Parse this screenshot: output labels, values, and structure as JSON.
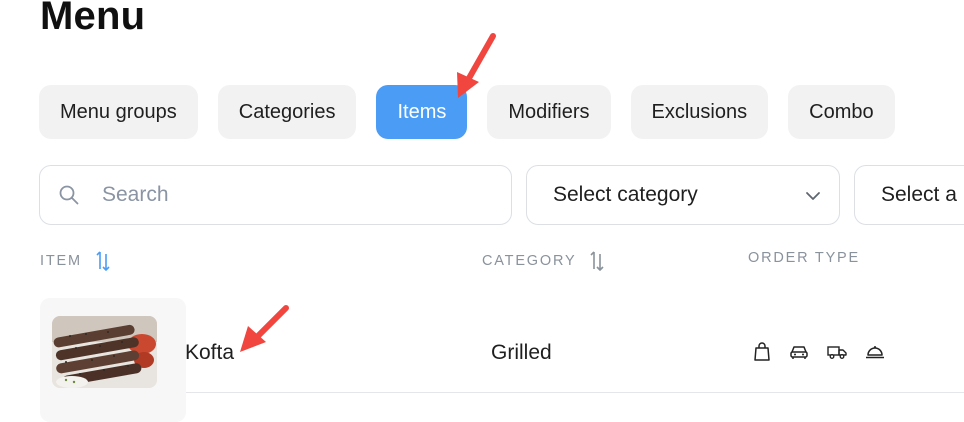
{
  "page": {
    "title": "Menu"
  },
  "tabs": [
    {
      "label": "Menu groups",
      "active": false
    },
    {
      "label": "Categories",
      "active": false
    },
    {
      "label": "Items",
      "active": true
    },
    {
      "label": "Modifiers",
      "active": false
    },
    {
      "label": "Exclusions",
      "active": false
    },
    {
      "label": "Combo",
      "active": false
    }
  ],
  "filters": {
    "search_placeholder": "Search",
    "category_select": "Select category",
    "second_select": "Select a"
  },
  "table": {
    "headers": {
      "item": "ITEM",
      "category": "CATEGORY",
      "order_type": "ORDER TYPE"
    },
    "rows": [
      {
        "name": "Kofta",
        "category": "Grilled",
        "order_type_icons": [
          "shopping-bag-icon",
          "car-icon",
          "delivery-truck-icon",
          "dine-in-cloche-icon"
        ]
      }
    ]
  },
  "colors": {
    "accent": "#4a9cf5",
    "tab_bg": "#f2f2f3",
    "annotation_arrow": "#f0463f"
  }
}
